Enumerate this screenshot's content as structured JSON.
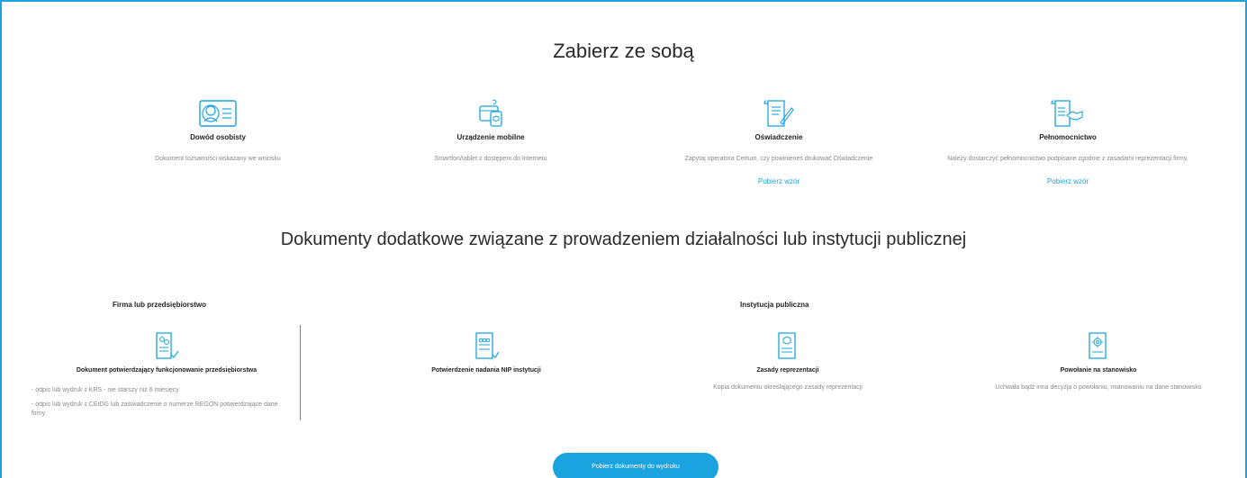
{
  "section1": {
    "title": "Zabierz ze sobą",
    "items": [
      {
        "icon": "id-card-icon",
        "title": "Dowód osobisty",
        "desc": "Dokument tożsamości wskazany we wniosku",
        "link": ""
      },
      {
        "icon": "mobile-device-icon",
        "title": "Urządzenie mobilne",
        "desc": "Smartfon/tablet z dostępem do Internetu",
        "link": ""
      },
      {
        "icon": "statement-document-icon",
        "title": "Oświadczenie",
        "desc": "Zapytaj operatora Certum, czy powinieneś drukować Oświadczenie",
        "link": "Pobierz wzór"
      },
      {
        "icon": "power-of-attorney-icon",
        "title": "Pełnomocnictwo",
        "desc": "Należy dostarczyć pełnomocnictwo podpisane zgodnie z zasadami reprezentacji firmy.",
        "link": "Pobierz wzór"
      }
    ]
  },
  "section2": {
    "title": "Dokumenty dodatkowe związane z prowadzeniem działalności lub instytucji publicznej",
    "firm_heading": "Firma lub przedsiębiorstwo",
    "institution_heading": "Instytucja publiczna",
    "docs": [
      {
        "icon": "business-document-icon",
        "title": "Dokument potwierdzający funkcjonowanie przedsiębiorstwa",
        "desc": ""
      },
      {
        "icon": "nip-document-icon",
        "title": "Potwierdzenie nadania NIP instytucji",
        "desc": ""
      },
      {
        "icon": "representation-rules-icon",
        "title": "Zasady reprezentacji",
        "desc": "Kopia dokumentu określającego zasady reprezentacji"
      },
      {
        "icon": "appointment-document-icon",
        "title": "Powołanie na stanowisko",
        "desc": "Uchwała bądź inna decyzja o powołaniu, mianowaniu na dane stanowisko"
      }
    ],
    "bullets": [
      "- odpis lub wydruk z KRS - nie starszy niż 6 miesięcy",
      "- odpis lub wydruk z CEIDG lub zaświadczenie o numerze REGON potwierdzające dane firmy"
    ]
  },
  "button": {
    "label": "Pobierz dokumenty do wydruku"
  },
  "colors": {
    "accent": "#1aa3de"
  }
}
